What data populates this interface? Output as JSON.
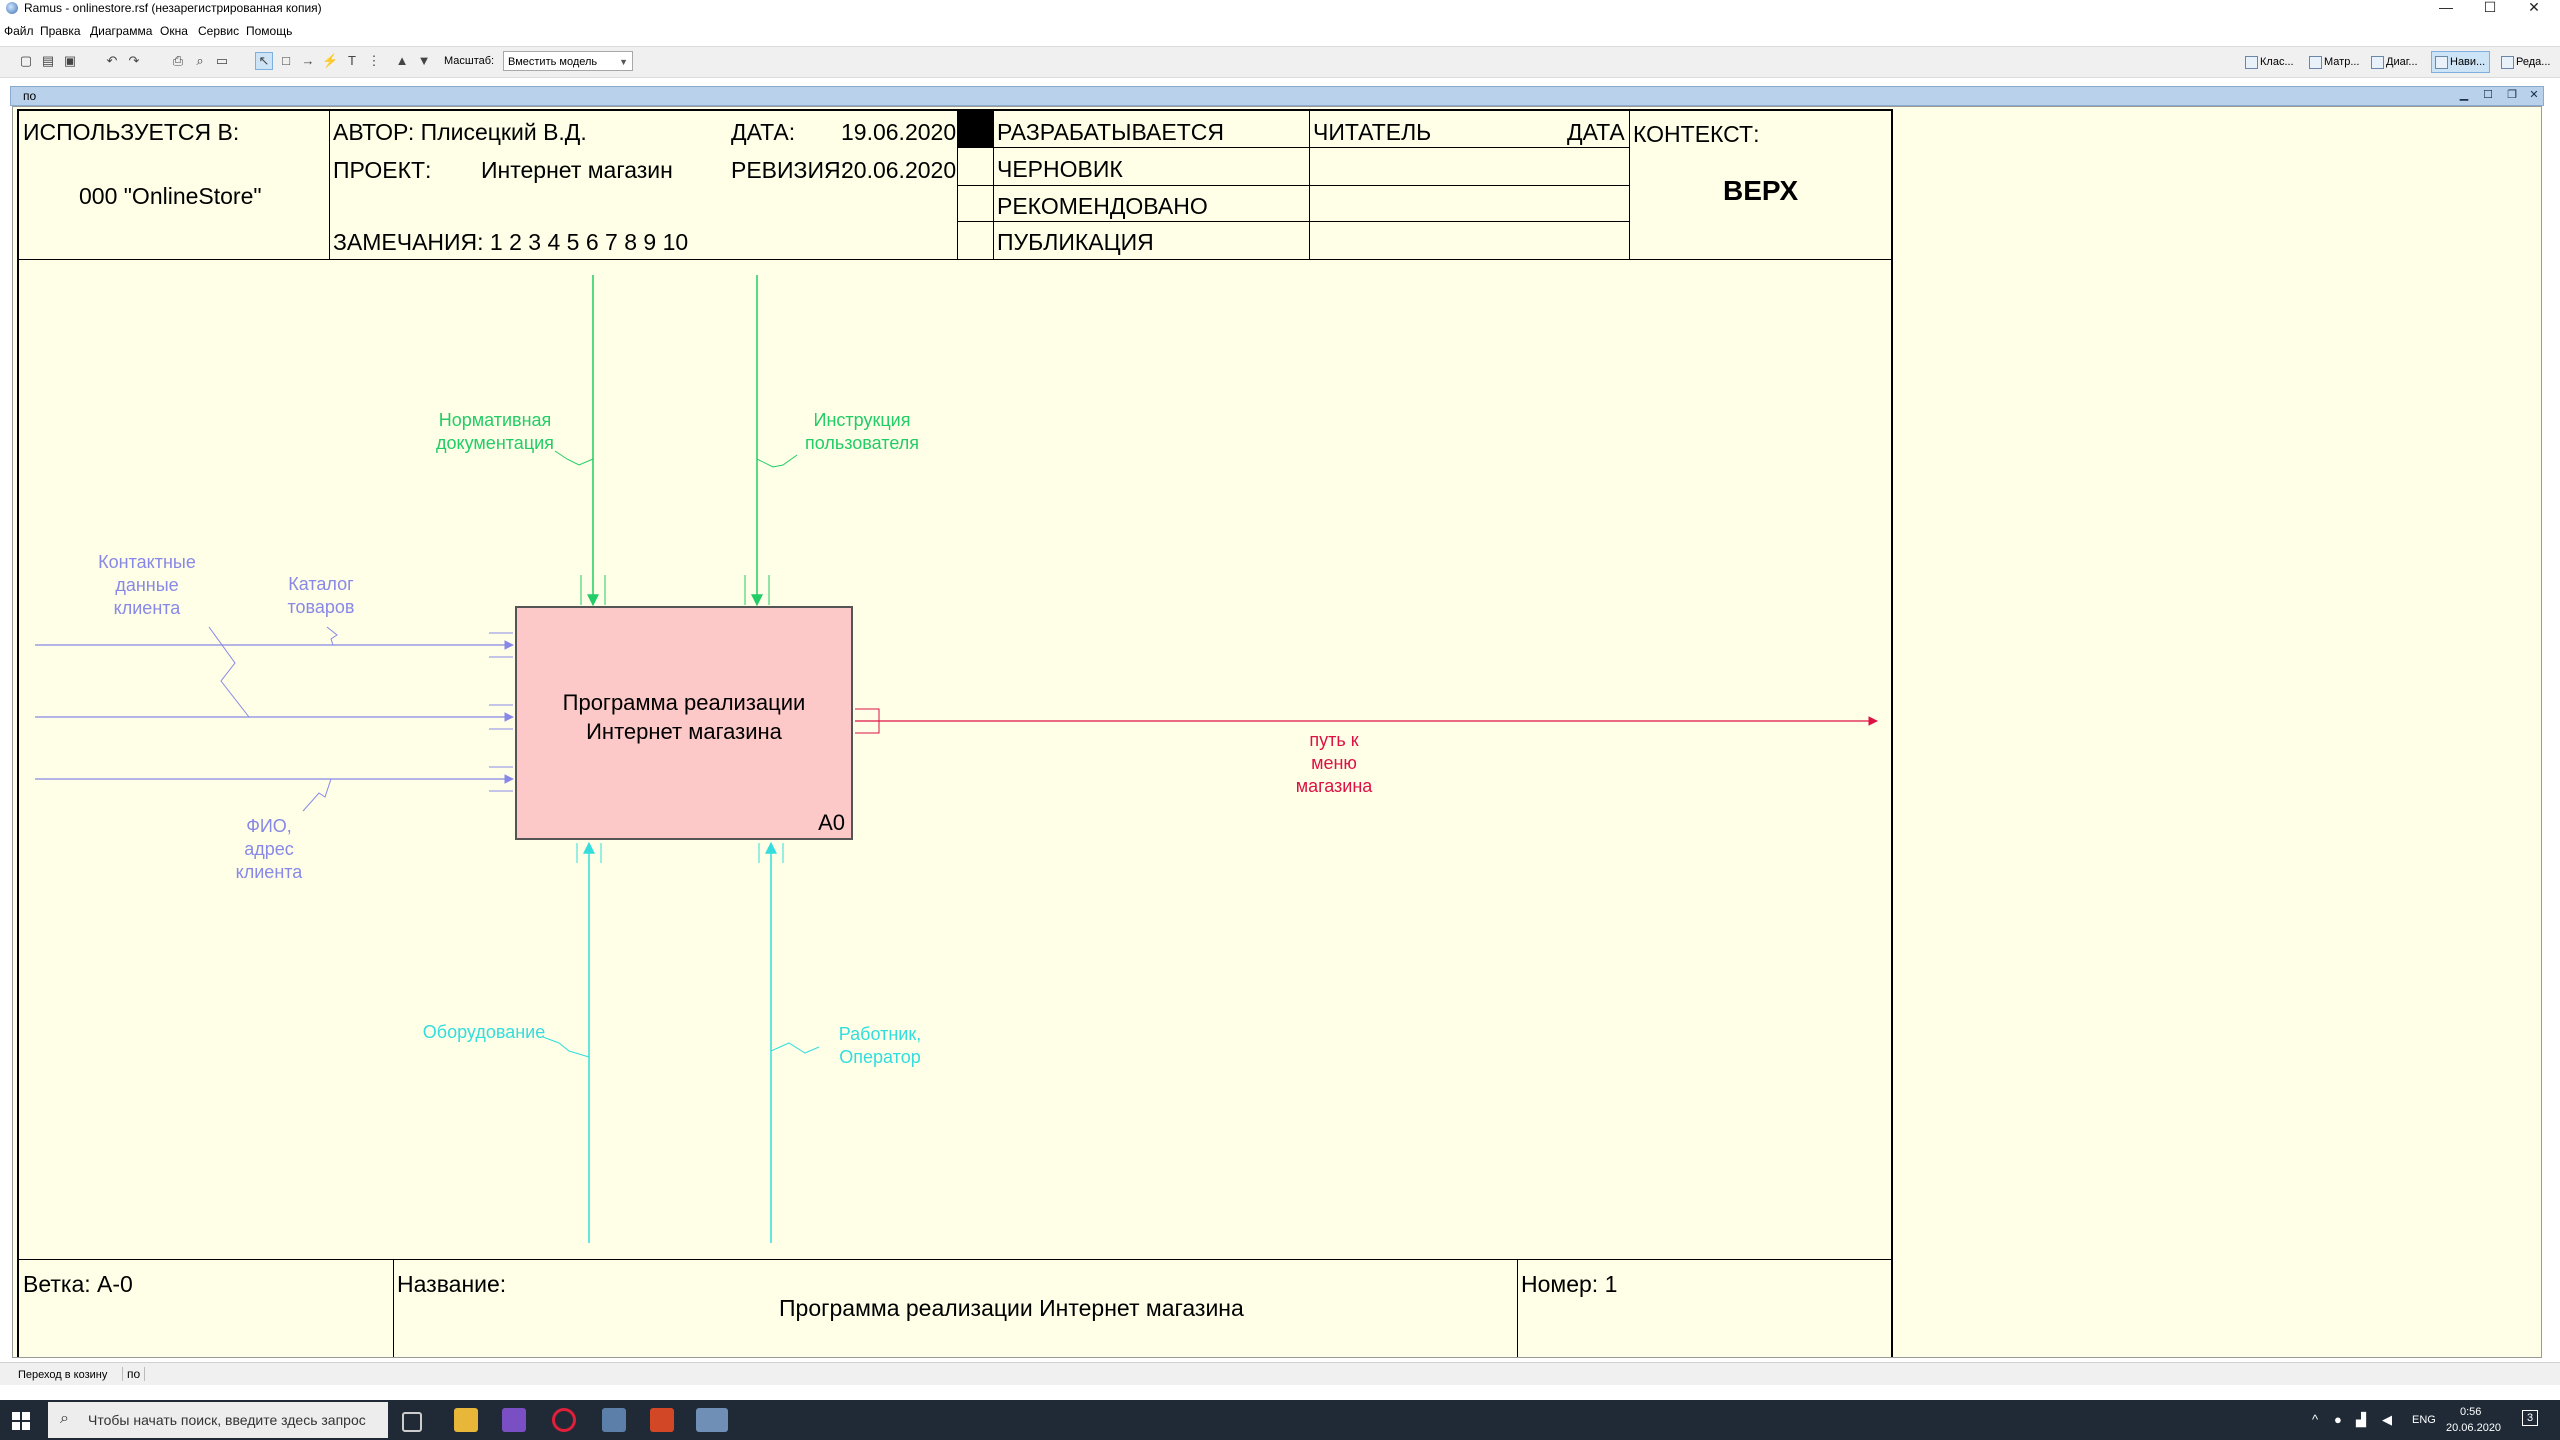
{
  "window": {
    "title": "Ramus - onlinestore.rsf (незарегистрированная копия)"
  },
  "menu": [
    "Файл",
    "Правка",
    "Диаграмма",
    "Окна",
    "Сервис",
    "Помощь"
  ],
  "toolbar": {
    "scale_label": "Масштаб:",
    "scale_value": "Вместить модель",
    "right_tabs": [
      "Клас...",
      "Матр...",
      "Диаг...",
      "Нави...",
      "Реда..."
    ],
    "active_right_tab": "Нави..."
  },
  "document": {
    "name": "по"
  },
  "header": {
    "used_in": "ИСПОЛЬЗУЕТСЯ В:",
    "org": "000 \"OnlineStore\"",
    "author_label": "АВТОР: Плисецкий В.Д.",
    "project_label": "ПРОЕКТ:",
    "project_value": "Интернет магазин",
    "notes": "ЗАМЕЧАНИЯ: 1 2 3 4 5 6 7 8 9 10",
    "date_label": "ДАТА:",
    "date_value": "19.06.2020",
    "rev_label": "РЕВИЗИЯ:",
    "rev_value": "20.06.2020",
    "status": [
      "РАЗРАБАТЫВАЕТСЯ",
      "ЧЕРНОВИК",
      "РЕКОМЕНДОВАНО",
      "ПУБЛИКАЦИЯ"
    ],
    "reader": "ЧИТАТЕЛЬ",
    "reader_date": "ДАТА",
    "context_label": "КОНТЕКСТ:",
    "context_value": "ВЕРХ"
  },
  "diagram": {
    "box_title": "Программа реализации\nИнтернет магазина",
    "box_number": "A0",
    "controls": [
      "Нормативная\nдокументация",
      "Инструкция\nпользователя"
    ],
    "inputs": [
      "Контактные\nданные\nклиента",
      "Каталог\nтоваров",
      "ФИО,\nадрес\nклиента"
    ],
    "mechanisms": [
      "Оборудование",
      "Работник,\nОператор"
    ],
    "outputs": [
      "путь к\nменю\nмагазина"
    ],
    "colors": {
      "control": "#22cc66",
      "input": "#8888e6",
      "mechanism": "#33dddd",
      "output": "#dd1144",
      "box_fill": "#fcc8c8",
      "canvas": "#ffffe8"
    }
  },
  "footer": {
    "node": "Ветка: А-0",
    "name_label": "Название:",
    "name_value": "Программа реализации Интернет магазина",
    "number": "Номер: 1"
  },
  "statusbar": {
    "left": "Переход в козину",
    "right": "по"
  },
  "taskbar": {
    "search_placeholder": "Чтобы начать поиск, введите здесь запрос",
    "lang": "ENG",
    "time": "0:56",
    "date": "20.06.2020",
    "notifications": "3"
  }
}
